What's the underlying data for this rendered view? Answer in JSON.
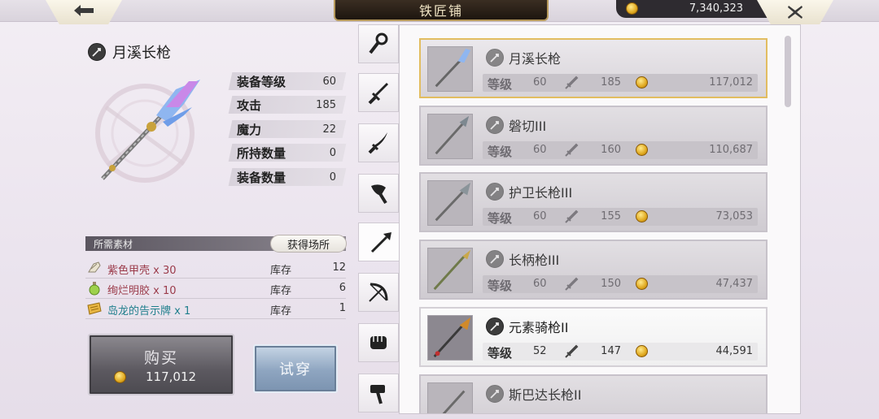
{
  "header": {
    "title": "铁匠铺",
    "gold": "7,340,323"
  },
  "detail": {
    "name": "月溪长枪",
    "stats": [
      {
        "label": "装备等级",
        "value": "60"
      },
      {
        "label": "攻击",
        "value": "185"
      },
      {
        "label": "魔力",
        "value": "22"
      },
      {
        "label": "所持数量",
        "value": "0"
      },
      {
        "label": "装备数量",
        "value": "0"
      }
    ],
    "materials_header": "所需素材",
    "source_button": "获得场所",
    "materials": [
      {
        "name": "紫色甲壳 x 30",
        "stock_label": "库存",
        "stock": "12",
        "color": "#9b3b4a"
      },
      {
        "name": "绚烂明胶 x 10",
        "stock_label": "库存",
        "stock": "6",
        "color": "#9b3b4a"
      },
      {
        "name": "岛龙的告示牌 x 1",
        "stock_label": "库存",
        "stock": "1",
        "color": "#1f7f8c"
      }
    ],
    "buy_label": "购买",
    "buy_price": "117,012",
    "try_label": "试穿"
  },
  "categories": [
    "staff-icon",
    "sword-icon",
    "katana-icon",
    "axe-icon",
    "spear-icon",
    "bow-icon",
    "fist-icon",
    "hammer-icon"
  ],
  "items": [
    {
      "name": "月溪长枪",
      "level_label": "等级",
      "level": "60",
      "attack": "185",
      "price": "117,012"
    },
    {
      "name": "磐切III",
      "level_label": "等级",
      "level": "60",
      "attack": "160",
      "price": "110,687"
    },
    {
      "name": "护卫长枪III",
      "level_label": "等级",
      "level": "60",
      "attack": "155",
      "price": "73,053"
    },
    {
      "name": "长柄枪III",
      "level_label": "等级",
      "level": "60",
      "attack": "150",
      "price": "47,437"
    },
    {
      "name": "元素骑枪II",
      "level_label": "等级",
      "level": "52",
      "attack": "147",
      "price": "44,591"
    },
    {
      "name": "斯巴达长枪II",
      "level_label": "等级",
      "level": "",
      "attack": "",
      "price": ""
    }
  ],
  "colors": {
    "selected_border": "#e2bd60",
    "material_red": "#9b3b4a",
    "material_teal": "#1f7f8c"
  }
}
